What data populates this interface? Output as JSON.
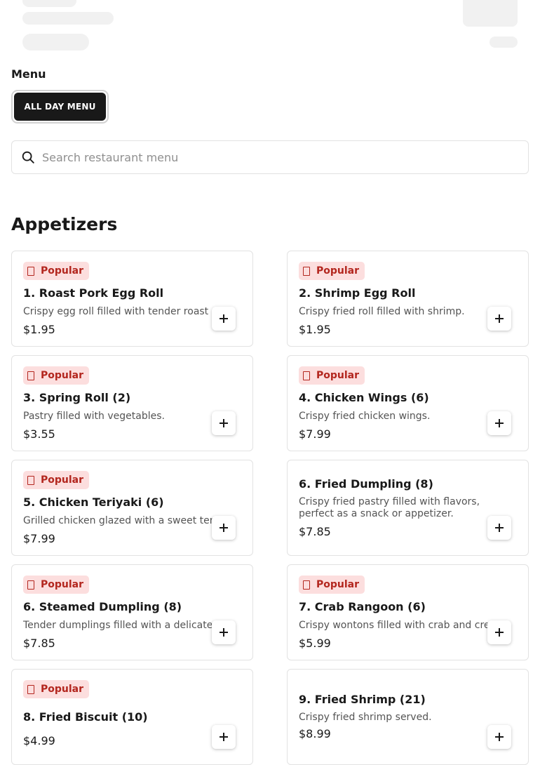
{
  "menu": {
    "label": "Menu",
    "tabs": [
      {
        "label": "ALL DAY MENU"
      }
    ]
  },
  "search": {
    "placeholder": "Search restaurant menu",
    "value": ""
  },
  "section": {
    "title": "Appetizers",
    "badge_label": "Popular"
  },
  "items": [
    {
      "name": "1. Roast Pork Egg Roll",
      "description": "Crispy egg roll filled with tender roast",
      "price": "$1.95",
      "popular": true
    },
    {
      "name": "2. Shrimp Egg Roll",
      "description": "Crispy fried roll filled with shrimp.",
      "price": "$1.95",
      "popular": true
    },
    {
      "name": "3. Spring Roll (2)",
      "description": "Pastry filled with vegetables.",
      "price": "$3.55",
      "popular": true
    },
    {
      "name": "4. Chicken Wings (6)",
      "description": "Crispy fried chicken wings.",
      "price": "$7.99",
      "popular": true
    },
    {
      "name": "5. Chicken Teriyaki (6)",
      "description": "Grilled chicken glazed with a sweet ter",
      "price": "$7.99",
      "popular": true
    },
    {
      "name": "6. Fried Dumpling (8)",
      "description": "Crispy fried pastry filled with flavors, perfect as a snack or appetizer.",
      "price": "$7.85",
      "popular": false
    },
    {
      "name": "6. Steamed Dumpling (8)",
      "description": "Tender dumplings filled with a delicate",
      "price": "$7.85",
      "popular": true
    },
    {
      "name": "7. Crab Rangoon (6)",
      "description": "Crispy wontons filled with crab and cre",
      "price": "$5.99",
      "popular": true
    },
    {
      "name": "8. Fried Biscuit (10)",
      "description": "",
      "price": "$4.99",
      "popular": true
    },
    {
      "name": "9. Fried Shrimp (21)",
      "description": "Crispy fried shrimp served.",
      "price": "$8.99",
      "popular": false
    }
  ],
  "icons": {
    "search": "search-icon",
    "badge": "popular-badge-icon",
    "add": "plus-icon"
  },
  "colors": {
    "primary": "#191919",
    "badge_bg": "#fcdede",
    "badge_text": "#b3261e",
    "border": "#e2e2e2"
  }
}
